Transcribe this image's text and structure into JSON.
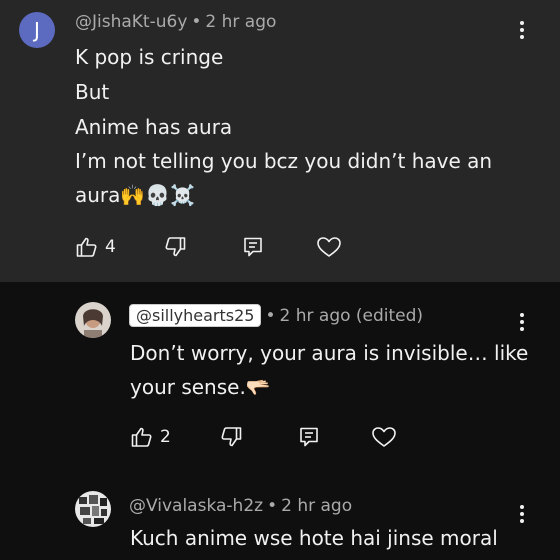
{
  "comments": [
    {
      "avatar_letter": "J",
      "author": "@JishaKt-u6y",
      "time": "2 hr ago",
      "lines": [
        "K pop is cringe",
        "But",
        "Anime has aura",
        "I’m not telling you bcz you didn’t have an",
        "aura🙌💀☠️"
      ],
      "likes": "4"
    },
    {
      "author": "@sillyhearts25",
      "time": "2 hr ago (edited)",
      "lines": [
        "Don’t worry, your aura is invisible… like",
        "your sense.🫳🏻"
      ],
      "likes": "2"
    },
    {
      "author": "@Vivalaska-h2z",
      "time": "2 hr ago",
      "lines": [
        "Kuch anime wse hote hai jinse moral"
      ]
    }
  ],
  "separator": "•",
  "icons": {
    "like": "thumbs-up-icon",
    "dislike": "thumbs-down-icon",
    "reply": "reply-icon",
    "heart": "heart-icon",
    "menu": "more-vert-icon"
  },
  "colors": {
    "top_comment_bg": "#272727",
    "page_bg": "#0f0f0f",
    "avatar_bg": "#5c6bc0",
    "text": "#f1f1f1",
    "meta": "#aaaaaa"
  }
}
